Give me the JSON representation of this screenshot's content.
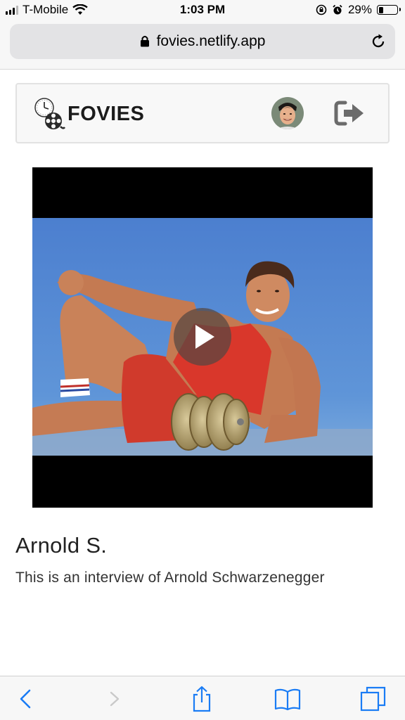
{
  "status_bar": {
    "carrier": "T-Mobile",
    "time": "1:03 PM",
    "battery": "29%",
    "battery_level": 0.29
  },
  "browser": {
    "url": "fovies.netlify.app"
  },
  "navbar": {
    "brand": "FOVIES"
  },
  "video": {
    "title": "Arnold S.",
    "description": "This is an interview of Arnold Schwarzenegger"
  },
  "colors": {
    "accent_ios_blue": "#1a7cf5",
    "video_background": "#000000",
    "stage_blue": "#4f86d3",
    "tank_top_red": "#d9372b"
  },
  "icons": {
    "lock": "lock-icon",
    "reload": "reload-icon",
    "logo": "clock-film-reel-logo",
    "logout": "logout-icon",
    "play": "play-icon",
    "back": "chevron-left-icon",
    "forward": "chevron-right-icon",
    "share": "share-icon",
    "bookmarks": "book-icon",
    "tabs": "tabs-icon"
  }
}
